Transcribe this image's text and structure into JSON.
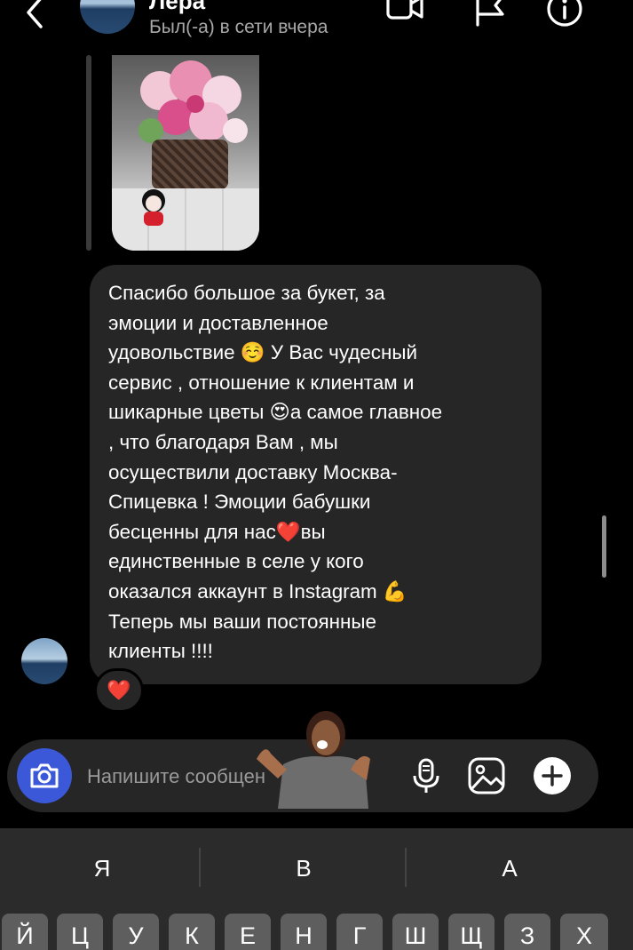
{
  "header": {
    "name": "Лера",
    "status": "Был(-а) в сети вчера",
    "icons": [
      "back-chevron-icon",
      "video-call-icon",
      "report-flag-icon",
      "info-icon"
    ]
  },
  "message": {
    "text": "Спасибо большое за букет, за\nэмоции и доставленное\nудовольствие ☺️ У Вас чудесный\nсервис , отношение к клиентам и\nшикарные цветы 😍а самое главное\n, что благодаря Вам , мы\nосуществили доставку Москва-\nСпицевка ! Эмоции бабушки\nбесценны для нас❤️вы\nединственные в селе у кого\nоказался аккаунт в Instagram 💪\nТеперь мы ваши постоянные\nклиенты !!!!",
    "reaction": "❤️"
  },
  "composer": {
    "placeholder": "Напишите сообщение...",
    "icons": [
      "camera-icon",
      "microphone-icon",
      "gallery-icon",
      "plus-icon"
    ],
    "accent_color": "#3a58d8"
  },
  "keyboard": {
    "suggestions": [
      "Я",
      "В",
      "А"
    ],
    "keys": [
      "Й",
      "Ц",
      "У",
      "К",
      "Е",
      "Н",
      "Г",
      "Ш",
      "Щ",
      "З",
      "Х"
    ]
  }
}
